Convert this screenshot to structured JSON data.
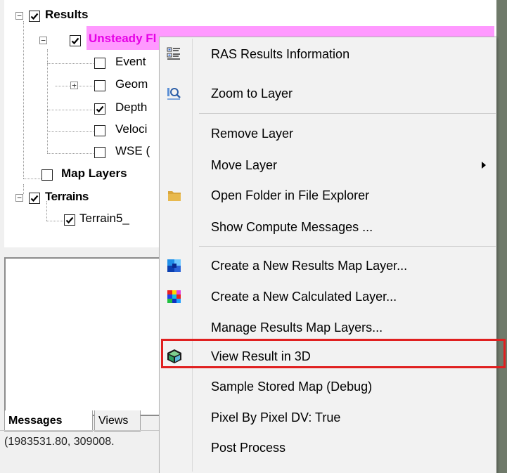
{
  "tree": {
    "results": {
      "label": "Results",
      "expander": "−",
      "checked": true
    },
    "unsteady": {
      "label": "Unsteady Fl",
      "expander": "−",
      "checked": true,
      "highlight_color": "#ff99ff",
      "text_color": "#e600e6"
    },
    "children": [
      {
        "label": "Event",
        "checked": false,
        "expander": ""
      },
      {
        "label": "Geom",
        "checked": false,
        "expander": "+"
      },
      {
        "label": "Depth",
        "checked": true,
        "expander": ""
      },
      {
        "label": "Veloci",
        "checked": false,
        "expander": ""
      },
      {
        "label": "WSE (",
        "checked": false,
        "expander": ""
      }
    ],
    "map_layers": {
      "label": "Map Layers",
      "checked": false
    },
    "terrains": {
      "label": "Terrains",
      "expander": "−",
      "checked": true
    },
    "terrain5": {
      "label": "Terrain5_",
      "checked": true
    }
  },
  "bottom": {
    "tabs": [
      {
        "label": "Messages",
        "active": true
      },
      {
        "label": "Views",
        "active": false
      }
    ],
    "status": "(1983531.80, 309008."
  },
  "context_menu": {
    "items": [
      {
        "label": "RAS Results Information",
        "icon": "results-info-icon"
      },
      {
        "label": "Zoom to Layer",
        "icon": "zoom-layer-icon"
      },
      {
        "label": "Remove Layer",
        "icon": ""
      },
      {
        "label": "Move Layer",
        "icon": "",
        "submenu": true
      },
      {
        "label": "Open Folder in File Explorer",
        "icon": "folder-icon"
      },
      {
        "label": "Show Compute Messages ...",
        "icon": ""
      },
      {
        "label": "Create a New Results Map Layer...",
        "icon": "results-map-layer-icon"
      },
      {
        "label": "Create a New Calculated Layer...",
        "icon": "calculated-layer-icon"
      },
      {
        "label": "Manage Results Map Layers...",
        "icon": ""
      },
      {
        "label": "View Result in 3D",
        "icon": "cube-3d-icon",
        "highlighted": true
      },
      {
        "label": "Sample Stored Map (Debug)",
        "icon": ""
      },
      {
        "label": "Pixel By Pixel DV: True",
        "icon": ""
      },
      {
        "label": "Post Process",
        "icon": ""
      }
    ],
    "highlight_color": "#e02020"
  }
}
